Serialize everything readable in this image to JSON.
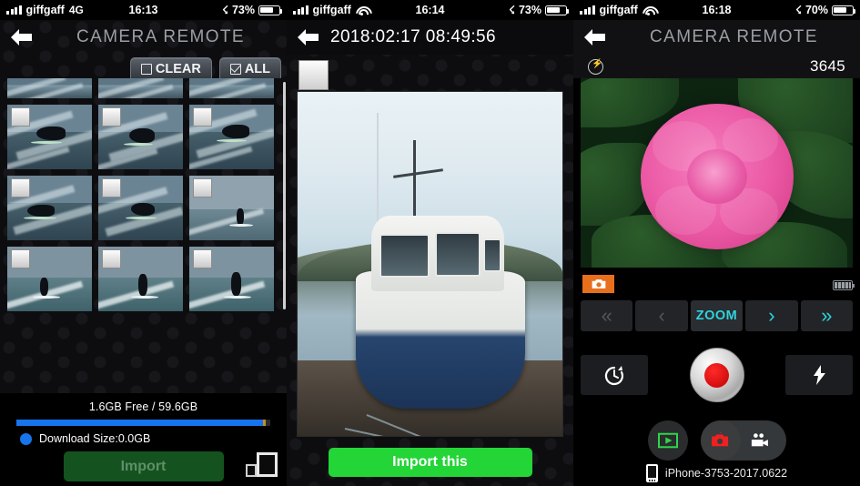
{
  "panels": [
    {
      "id": "import-gallery",
      "statusbar": {
        "carrier": "giffgaff",
        "network": "4G",
        "time": "16:13",
        "bluetooth_icon": "bluetooth-icon",
        "battery_percent": "73%",
        "battery_level": 73
      },
      "header": {
        "back_icon": "back-arrow-icon",
        "title": "CAMERA REMOTE",
        "clear_label": "CLEAR",
        "clear_icon": "checkbox-empty-icon",
        "all_label": "ALL",
        "all_icon": "checkbox-checked-icon"
      },
      "footer": {
        "storage_text": "1.6GB Free / 59.6GB",
        "storage_used_percent": 97,
        "download_size_text": "Download Size:0.0GB",
        "import_label": "Import",
        "import_enabled": false,
        "thumb_size_icon": "thumbnail-size-toggle-icon"
      },
      "grid": {
        "rows": 4,
        "columns": 3,
        "first_row_partial": true,
        "items": [
          {
            "checked": false,
            "art": "wave"
          },
          {
            "checked": false,
            "art": "wave"
          },
          {
            "checked": false,
            "art": "wave"
          },
          {
            "checked": false,
            "art": "surfer-crouch"
          },
          {
            "checked": false,
            "art": "surfer-crouch"
          },
          {
            "checked": false,
            "art": "surfer-crouch"
          },
          {
            "checked": false,
            "art": "surfer-crouch"
          },
          {
            "checked": false,
            "art": "surfer-crouch"
          },
          {
            "checked": false,
            "art": "surfer-stand"
          },
          {
            "checked": false,
            "art": "surfer-stand"
          },
          {
            "checked": false,
            "art": "surfer-stand"
          },
          {
            "checked": false,
            "art": "surfer-stand"
          }
        ]
      }
    },
    {
      "id": "photo-detail",
      "statusbar": {
        "carrier": "giffgaff",
        "network": "wifi",
        "time": "16:14",
        "bluetooth_icon": "bluetooth-icon",
        "battery_percent": "73%",
        "battery_level": 73
      },
      "header": {
        "back_icon": "back-arrow-icon",
        "title": "2018:02:17 08:49:56"
      },
      "select_checkbox": {
        "name": "select-photo-checkbox",
        "checked": false
      },
      "photo": {
        "subject": "boat-on-estuary"
      },
      "import_label": "Import this"
    },
    {
      "id": "camera-remote-live",
      "statusbar": {
        "carrier": "giffgaff",
        "network": "wifi",
        "time": "16:18",
        "bluetooth_icon": "bluetooth-icon",
        "battery_percent": "70%",
        "battery_level": 70
      },
      "header": {
        "back_icon": "back-arrow-icon",
        "title": "CAMERA REMOTE",
        "flash_icon": "flash-off-icon",
        "shot_count": "3645"
      },
      "liveview": {
        "subject": "pink-camellia-flower"
      },
      "mode_badge": {
        "icon": "camera-icon"
      },
      "camera_battery_icon": "camera-battery-icon",
      "zoom_bar": {
        "fast_rewind_icon": "double-chevron-left-icon",
        "step_back_icon": "chevron-left-icon",
        "label": "ZOOM",
        "step_forward_icon": "chevron-right-icon",
        "fast_forward_icon": "double-chevron-right-icon"
      },
      "controls": {
        "timer_icon": "self-timer-icon",
        "shutter_icon": "shutter-record-button",
        "flash_icon": "flash-bolt-icon"
      },
      "bottom": {
        "playback_icon": "play-green-icon",
        "photo_mode_icon": "camera-red-icon",
        "video_mode_icon": "video-camera-icon",
        "device_icon": "phone-icon",
        "device_name": "iPhone-3753-2017.0622"
      }
    }
  ],
  "colors": {
    "accent_cyan": "#2fd3dd",
    "import_green": "#23d537",
    "import_disabled_green": "#14531f",
    "progress_blue": "#1675ec",
    "badge_orange": "#e8701c",
    "record_red": "#e02020"
  }
}
